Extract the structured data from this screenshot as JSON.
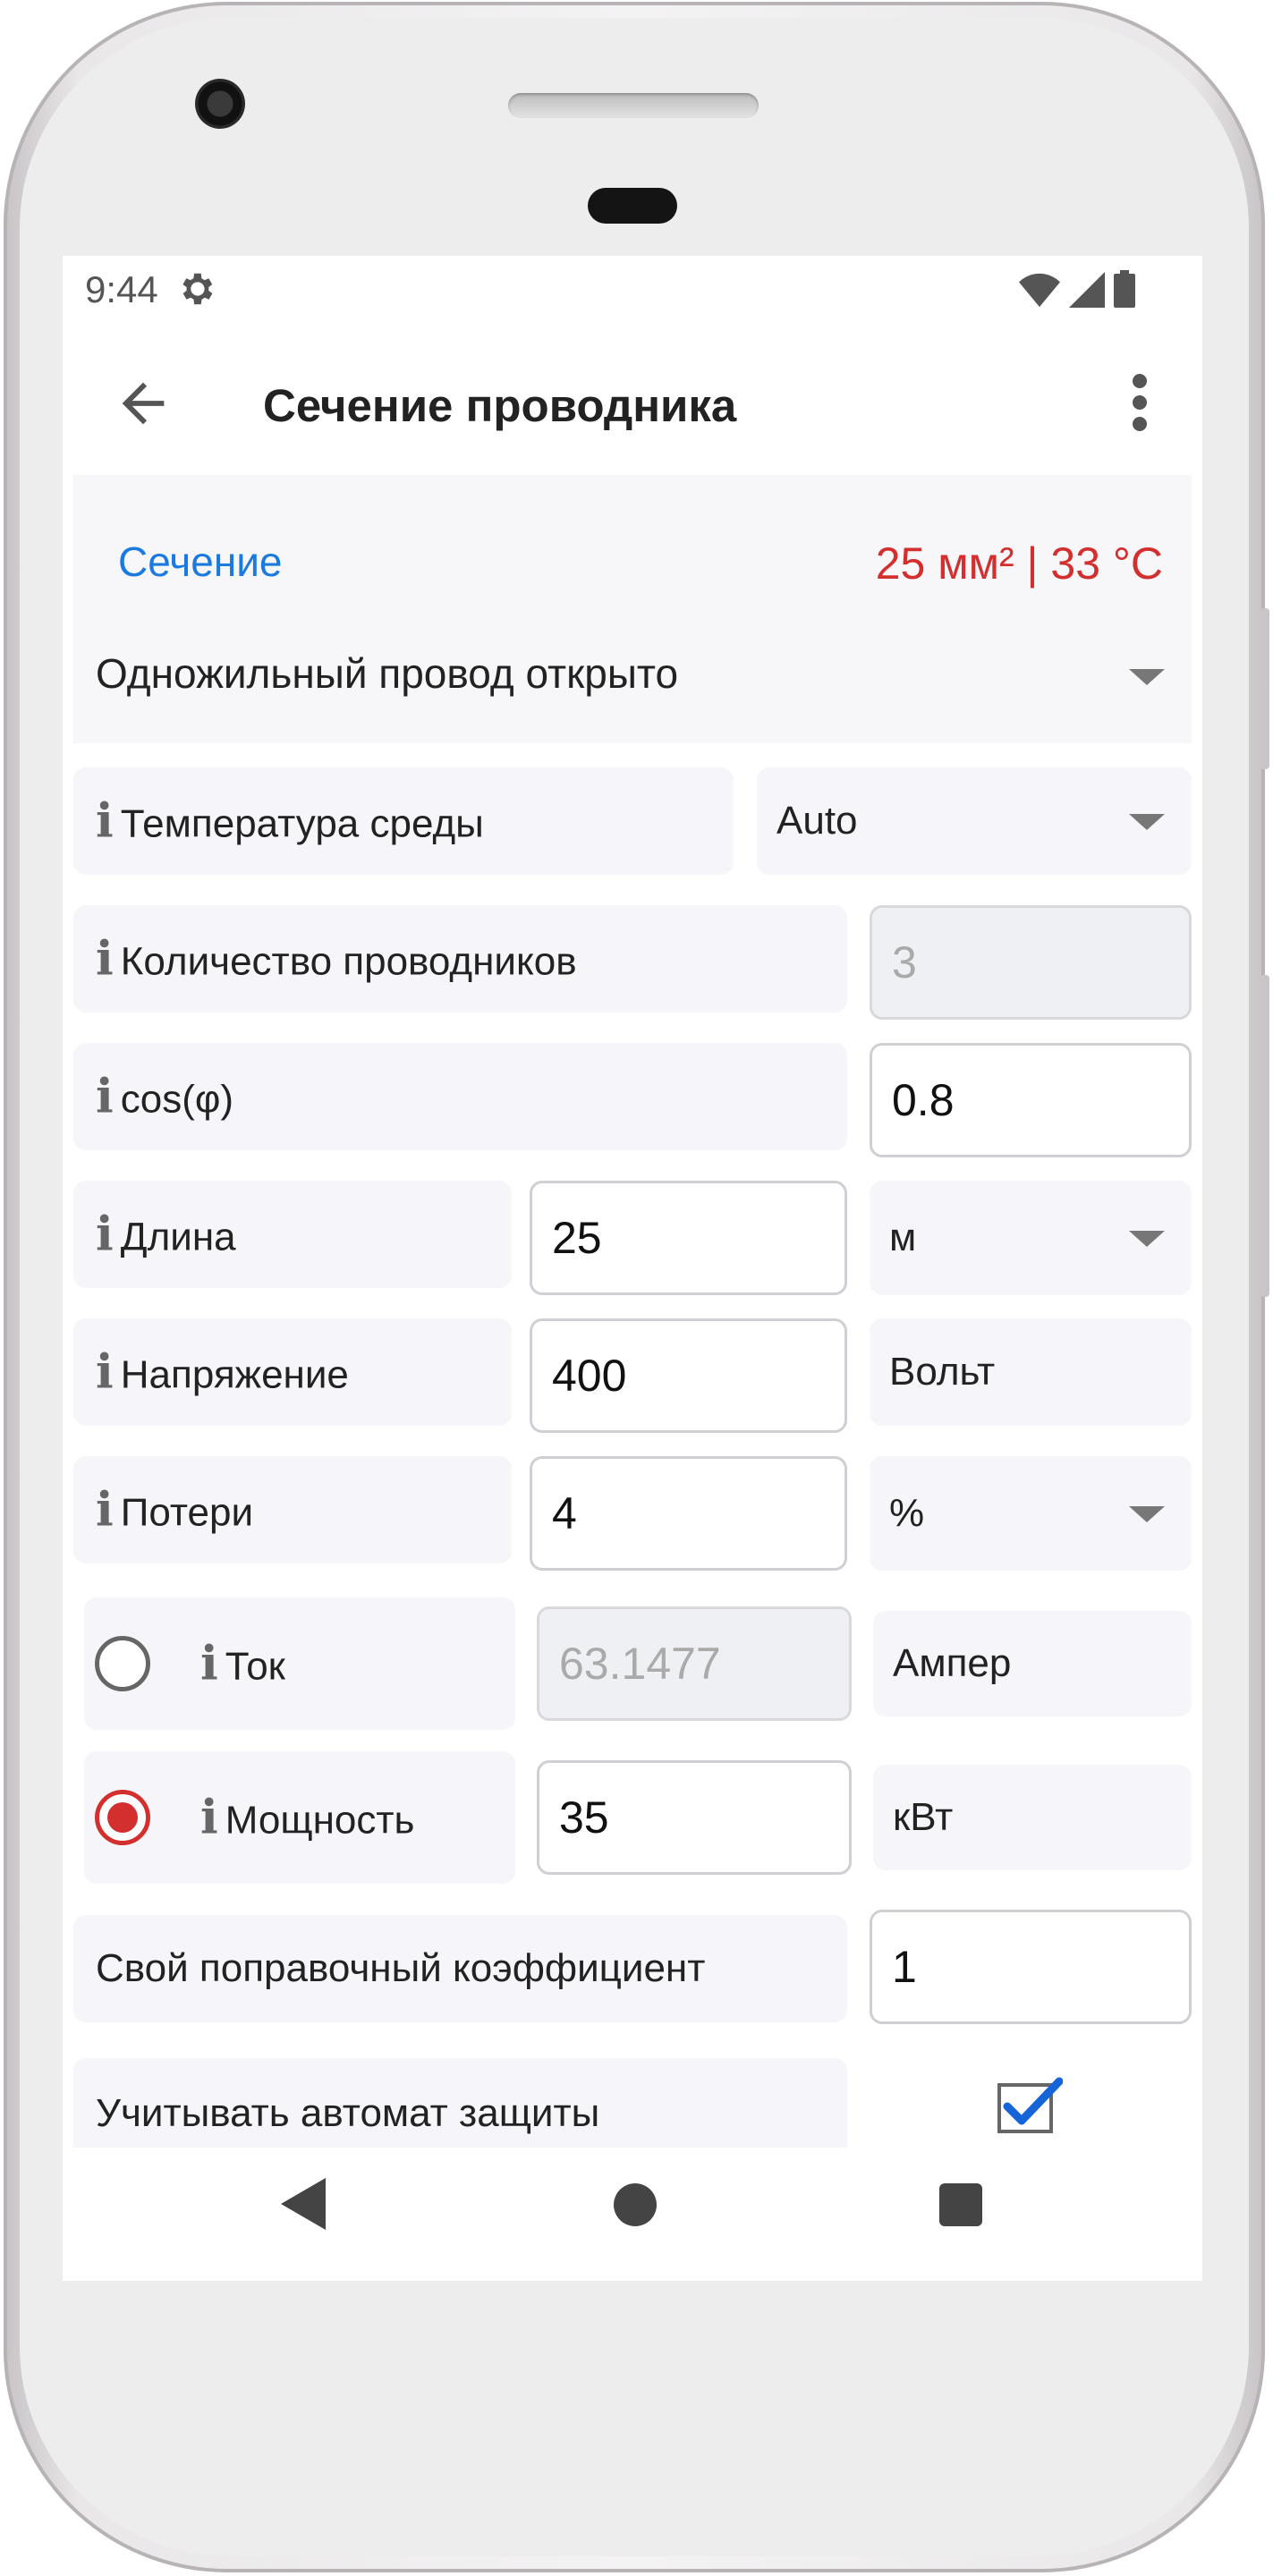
{
  "status_bar": {
    "time": "9:44",
    "icons": [
      "gear-icon",
      "wifi-icon",
      "signal-icon",
      "battery-icon"
    ]
  },
  "app_bar": {
    "title": "Сечение проводника",
    "back_icon": "arrow-left-icon",
    "menu_icon": "more-vert-icon"
  },
  "summary": {
    "label": "Сечение",
    "result": "25 мм² | 33 °C"
  },
  "wire_type": {
    "selected": "Одножильный провод открыто"
  },
  "ambient_temperature": {
    "label": "Температура среды",
    "selected": "Auto"
  },
  "conductor_count": {
    "label": "Количество проводников",
    "value": "3"
  },
  "cos_phi": {
    "label": "cos(φ)",
    "value": "0.8"
  },
  "length": {
    "label": "Длина",
    "value": "25",
    "unit": "м"
  },
  "voltage": {
    "label": "Напряжение",
    "value": "400",
    "unit": "Вольт"
  },
  "losses": {
    "label": "Потери",
    "value": "4",
    "unit": "%"
  },
  "current": {
    "label": "Ток",
    "value": "63.1477",
    "unit": "Ампер",
    "selected": false
  },
  "power": {
    "label": "Мощность",
    "value": "35",
    "unit": "кВт",
    "selected": true
  },
  "correction_factor": {
    "label": "Свой поправочный коэффициент",
    "value": "1"
  },
  "breaker": {
    "label": "Учитывать автомат защиты",
    "checked": true
  },
  "info_glyph": "i",
  "colors": {
    "accent_blue": "#1a7ae0",
    "result_red": "#d32f2f",
    "cell_bg": "#f6f6fa"
  }
}
